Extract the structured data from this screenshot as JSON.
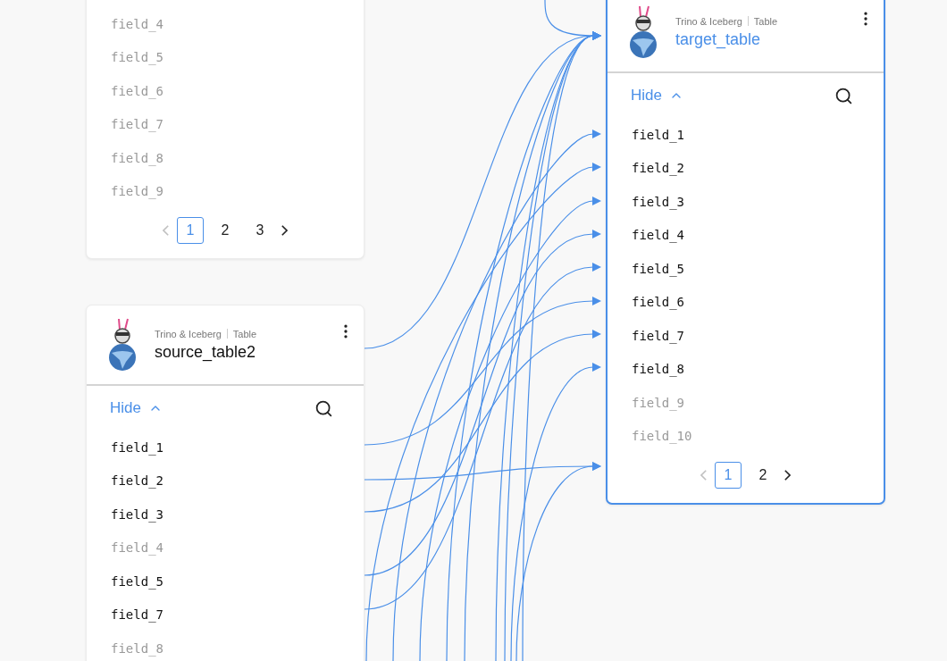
{
  "cards": [
    {
      "selected": false,
      "fields": [
        {
          "name": "field_4",
          "dimmed": true
        },
        {
          "name": "field_5",
          "dimmed": true
        },
        {
          "name": "field_6",
          "dimmed": true
        },
        {
          "name": "field_7",
          "dimmed": true
        },
        {
          "name": "field_8",
          "dimmed": true
        },
        {
          "name": "field_9",
          "dimmed": true
        }
      ],
      "pagination": {
        "prev_disabled": true,
        "next_disabled": false,
        "pages": [
          {
            "label": "1",
            "selected": true
          },
          {
            "label": "2",
            "selected": false
          },
          {
            "label": "3",
            "selected": false
          }
        ]
      }
    },
    {
      "selected": false,
      "header": {
        "engine": "Trino & Iceberg",
        "type": "Table",
        "name": "source_table2"
      },
      "toggle": {
        "label": "Hide",
        "expanded": true
      },
      "fields": [
        {
          "name": "field_1",
          "dimmed": false
        },
        {
          "name": "field_2",
          "dimmed": false
        },
        {
          "name": "field_3",
          "dimmed": false
        },
        {
          "name": "field_4",
          "dimmed": true
        },
        {
          "name": "field_5",
          "dimmed": false
        },
        {
          "name": "field_7",
          "dimmed": false
        },
        {
          "name": "field_8",
          "dimmed": true
        }
      ]
    },
    {
      "selected": true,
      "header": {
        "engine": "Trino & Iceberg",
        "type": "Table",
        "name": "target_table"
      },
      "toggle": {
        "label": "Hide",
        "expanded": true
      },
      "fields": [
        {
          "name": "field_1",
          "dimmed": false
        },
        {
          "name": "field_2",
          "dimmed": false
        },
        {
          "name": "field_3",
          "dimmed": false
        },
        {
          "name": "field_4",
          "dimmed": false
        },
        {
          "name": "field_5",
          "dimmed": false
        },
        {
          "name": "field_6",
          "dimmed": false
        },
        {
          "name": "field_7",
          "dimmed": false
        },
        {
          "name": "field_8",
          "dimmed": false
        },
        {
          "name": "field_9",
          "dimmed": true
        },
        {
          "name": "field_10",
          "dimmed": true
        }
      ],
      "pagination": {
        "prev_disabled": true,
        "next_disabled": false,
        "pages": [
          {
            "label": "1",
            "selected": true
          },
          {
            "label": "2",
            "selected": false
          }
        ]
      }
    }
  ]
}
